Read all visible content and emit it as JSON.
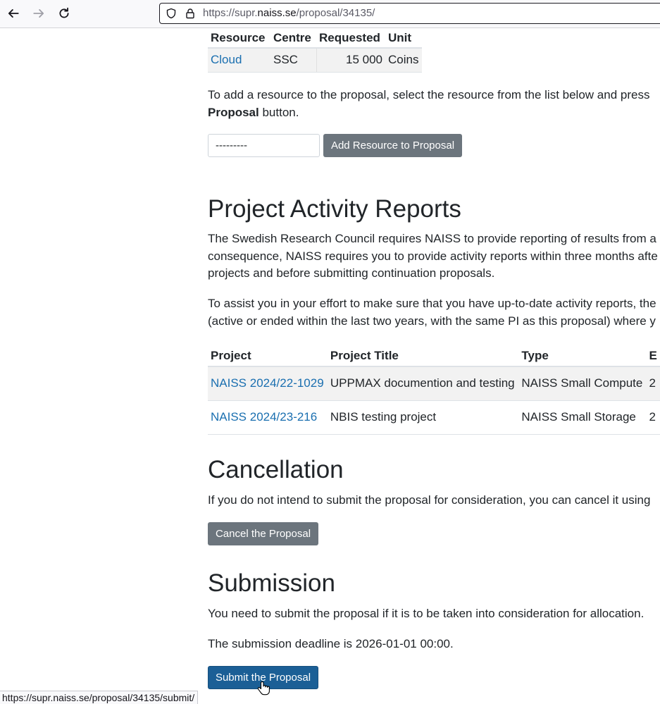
{
  "browser": {
    "url_prefix": "https://supr.",
    "url_domain": "naiss.se",
    "url_path": "/proposal/34135/",
    "status_url": "https://supr.naiss.se/proposal/34135/submit/"
  },
  "resources_table": {
    "headers": [
      "Resource",
      "Centre",
      "Requested",
      "Unit"
    ],
    "row": {
      "resource": "Cloud",
      "centre": "SSC",
      "requested": "15 000",
      "unit": "Coins"
    }
  },
  "add_resource": {
    "text_before": "To add a resource to the proposal, select the resource from the list below and press",
    "text_bold": "Proposal",
    "text_after": " button.",
    "select_value": "---------",
    "button_label": "Add Resource to Proposal"
  },
  "activity_reports": {
    "heading": "Project Activity Reports",
    "para1_line1": "The Swedish Research Council requires NAISS to provide reporting of results from a",
    "para1_line2": "consequence, NAISS requires you to provide activity reports within three months afte",
    "para1_line3": "projects and before submitting continuation proposals.",
    "para2_line1": "To assist you in your effort to make sure that you have up-to-date activity reports, the",
    "para2_line2": "(active or ended within the last two years, with the same PI as this proposal) where y",
    "table_headers": [
      "Project",
      "Project Title",
      "Type",
      "E"
    ],
    "projects": [
      {
        "project": "NAISS 2024/22-1029",
        "title": "UPPMAX documention and testing",
        "type": "NAISS Small Compute",
        "extra": "2"
      },
      {
        "project": "NAISS 2024/23-216",
        "title": "NBIS testing project",
        "type": "NAISS Small Storage",
        "extra": "2"
      }
    ]
  },
  "cancellation": {
    "heading": "Cancellation",
    "text": "If you do not intend to submit the proposal for consideration, you can cancel it using",
    "button_label": "Cancel the Proposal"
  },
  "submission": {
    "heading": "Submission",
    "text1": "You need to submit the proposal if it is to be taken into consideration for allocation.",
    "text2": "The submission deadline is 2026-01-01 00:00.",
    "button_label": "Submit the Proposal"
  }
}
